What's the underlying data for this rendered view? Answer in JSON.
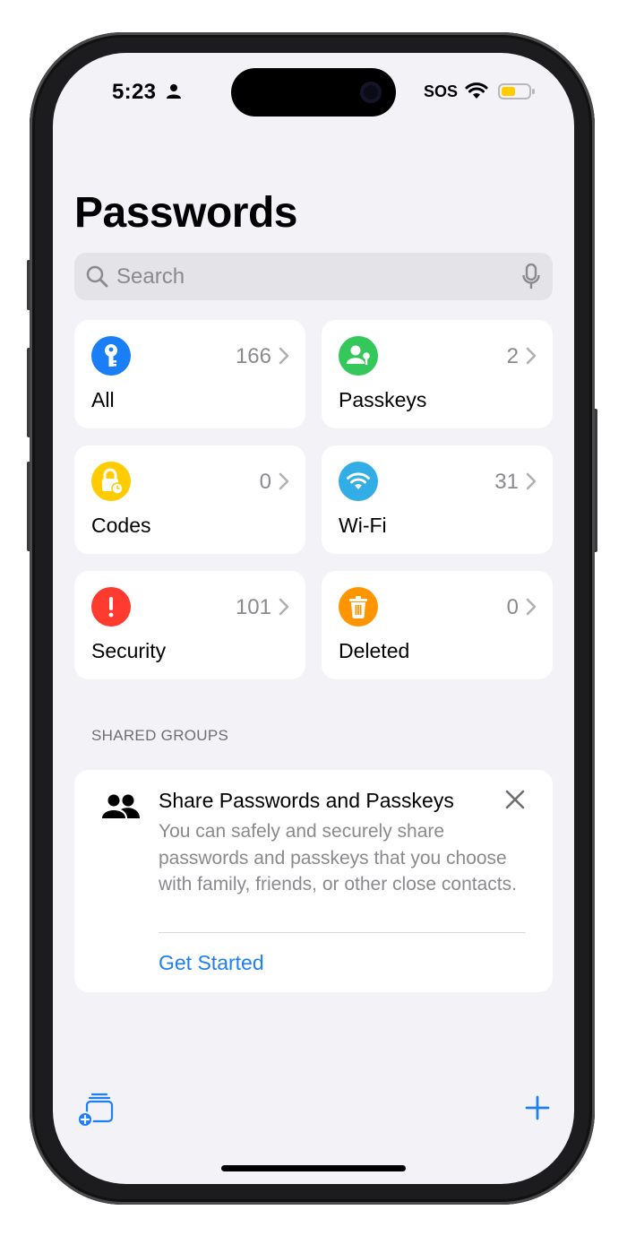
{
  "status_bar": {
    "time": "5:23",
    "sos": "SOS"
  },
  "page": {
    "title": "Passwords"
  },
  "search": {
    "placeholder": "Search"
  },
  "categories": [
    {
      "label": "All",
      "count": "166",
      "icon": "key-icon",
      "color": "#1a7ef7"
    },
    {
      "label": "Passkeys",
      "count": "2",
      "icon": "person-key-icon",
      "color": "#34c759"
    },
    {
      "label": "Codes",
      "count": "0",
      "icon": "lock-clock-icon",
      "color": "#ffcc00"
    },
    {
      "label": "Wi-Fi",
      "count": "31",
      "icon": "wifi-icon",
      "color": "#32ade6"
    },
    {
      "label": "Security",
      "count": "101",
      "icon": "exclamation-icon",
      "color": "#ff3b30"
    },
    {
      "label": "Deleted",
      "count": "0",
      "icon": "trash-icon",
      "color": "#ff9500"
    }
  ],
  "shared_groups": {
    "header": "SHARED GROUPS",
    "card_title": "Share Passwords and Passkeys",
    "card_body": "You can safely and securely share passwords and passkeys that you choose with family, friends, or other close contacts.",
    "cta": "Get Started"
  },
  "toolbar": {
    "left_icon": "new-group-icon",
    "right_icon": "plus-icon"
  },
  "colors": {
    "accent": "#1f7ef2",
    "background": "#f2f2f7"
  }
}
